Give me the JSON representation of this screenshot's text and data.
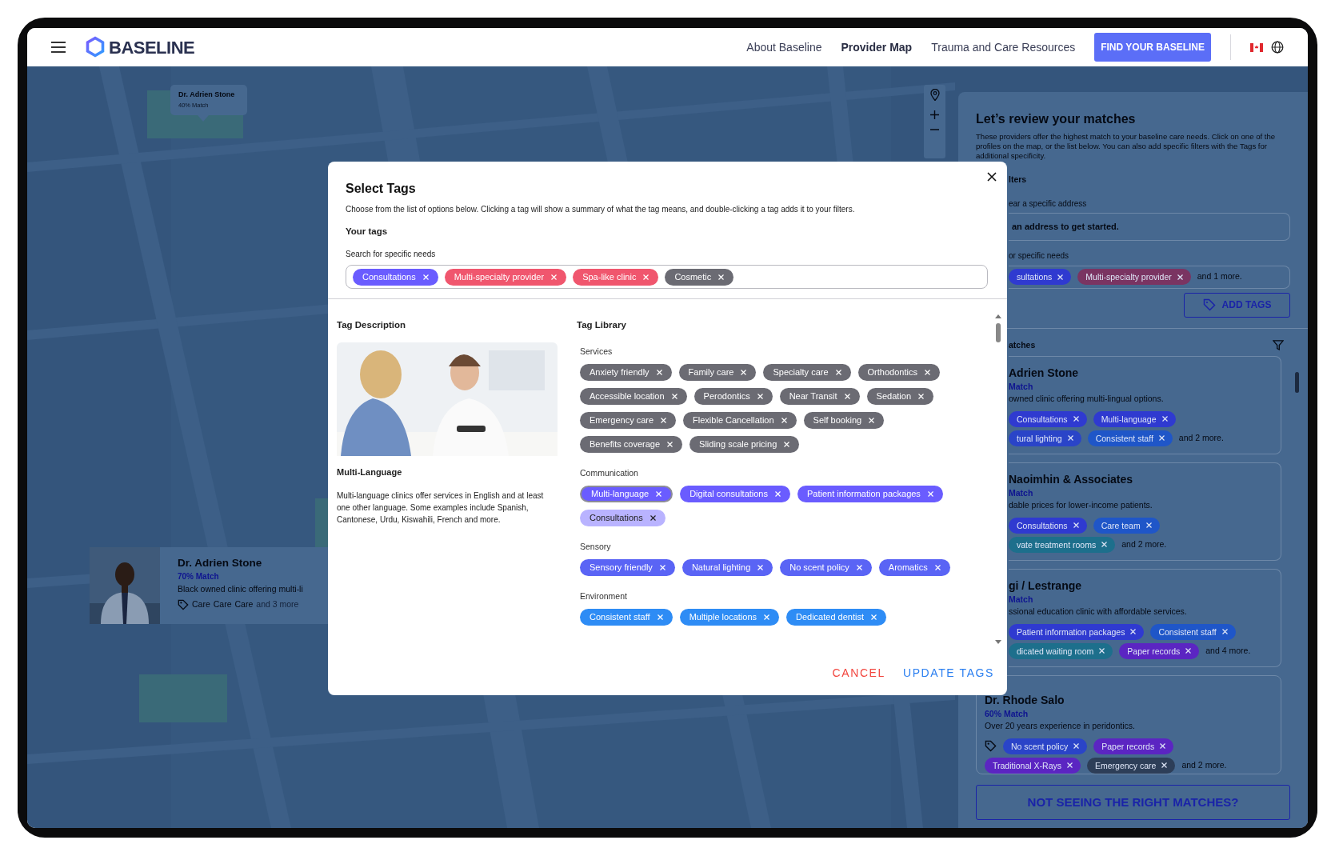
{
  "header": {
    "logo": "BASELINE",
    "nav": [
      {
        "label": "About Baseline",
        "selected": false
      },
      {
        "label": "Provider Map",
        "selected": true
      },
      {
        "label": "Trauma and Care Resources",
        "selected": false
      }
    ],
    "cta": "FIND YOUR BASELINE"
  },
  "map": {
    "kind": "picture",
    "pin": {
      "name": "Dr. Adrien Stone",
      "match": "40% Match"
    },
    "profile_card": {
      "name": "Dr. Adrien Stone",
      "match": "70% Match",
      "description": "Black owned clinic offering multi-li",
      "tags": [
        "Care",
        "Care",
        "Care"
      ],
      "more": "and 3 more"
    }
  },
  "matches_panel": {
    "title": "Let’s review your matches",
    "description": "These providers offer the highest match to your baseline care needs. Click on one of the profiles on the map, or the list below. You can also add specific filters with the Tags for additional specificity.",
    "filters_heading": "lters",
    "address_label": "ear a specific address",
    "address_placeholder": "an address to get started.",
    "needs_label": "or specific needs",
    "needs_tags": [
      {
        "label": "sultations",
        "color": "#2f3ad0"
      },
      {
        "label": "Multi-specialty provider",
        "color": "#7a3462"
      }
    ],
    "needs_more": "and 1 more.",
    "add_tags_button": "ADD TAGS",
    "matches_heading": "atches",
    "matches": [
      {
        "name": "Adrien Stone",
        "match": "Match",
        "description": "owned clinic offering multi-lingual options.",
        "tag_rows": [
          [
            {
              "label": "Consultations",
              "color": "#2f3ad0"
            },
            {
              "label": "Multi-language",
              "color": "#2f3ad0"
            }
          ],
          [
            {
              "label": "tural lighting",
              "color": "#2a44c8"
            },
            {
              "label": "Consistent staff",
              "color": "#1f56c8"
            }
          ]
        ],
        "more": "and 2 more."
      },
      {
        "name": "Naoimhin & Associates",
        "match": "Match",
        "description": "dable prices for lower-income patients.",
        "tag_rows": [
          [
            {
              "label": "Consultations",
              "color": "#2f3ad0"
            },
            {
              "label": "Care team",
              "color": "#1f56c8"
            }
          ],
          [
            {
              "label": "vate treatment rooms",
              "color": "#1d6f8c"
            }
          ]
        ],
        "more": "and 2 more."
      },
      {
        "name": "gi / Lestrange",
        "match": "Match",
        "description": "ssional education clinic with affordable services.",
        "tag_rows": [
          [
            {
              "label": "Patient information packages",
              "color": "#2f3ad0"
            },
            {
              "label": "Consistent staff",
              "color": "#1f56c8"
            }
          ],
          [
            {
              "label": "dicated waiting room",
              "color": "#1d6f8c"
            },
            {
              "label": "Paper records",
              "color": "#5b25c2"
            }
          ]
        ],
        "more": "and 4 more."
      },
      {
        "name": "Dr. Rhode Salo",
        "match": "60% Match",
        "description": "Over 20 years experience in peridontics.",
        "tag_rows": [
          [
            {
              "label": "No scent policy",
              "color": "#2a44c8"
            },
            {
              "label": "Paper records",
              "color": "#5b25c2"
            }
          ],
          [
            {
              "label": "Traditional X-Rays",
              "color": "#5b25c2"
            },
            {
              "label": "Emergency care",
              "color": "#2d3e58"
            }
          ]
        ],
        "more": "and 2 more."
      }
    ],
    "bottom_button": "NOT SEEING THE RIGHT MATCHES?"
  },
  "modal": {
    "title": "Select Tags",
    "description": "Choose from the list of options below. Clicking a tag will show a summary of what the tag means, and double-clicking a tag adds it to your filters.",
    "your_tags_heading": "Your tags",
    "search_label": "Search for specific needs",
    "your_tags": [
      {
        "label": "Consultations",
        "color": "#6a5cff"
      },
      {
        "label": "Multi-specialty provider",
        "color": "#f0566e"
      },
      {
        "label": "Spa-like clinic",
        "color": "#f0566e"
      },
      {
        "label": "Cosmetic",
        "color": "#6b6b73"
      }
    ],
    "description_heading": "Tag Description",
    "tag_name": "Multi-Language",
    "tag_text": "Multi-language clinics offer services in English and at least one other language. Some examples include Spanish, Cantonese, Urdu, Kiswahili, French and more.",
    "library_heading": "Tag Library",
    "groups": [
      {
        "name": "Services",
        "tags": [
          {
            "label": "Anxiety friendly",
            "color": "#6b6b73",
            "selected": false,
            "added": false
          },
          {
            "label": "Family care",
            "color": "#6b6b73",
            "selected": false,
            "added": false
          },
          {
            "label": "Specialty care",
            "color": "#6b6b73",
            "selected": false,
            "added": false
          },
          {
            "label": "Orthodontics",
            "color": "#6b6b73",
            "selected": false,
            "added": false
          },
          {
            "label": "Accessible location",
            "color": "#6b6b73",
            "selected": false,
            "added": false
          },
          {
            "label": "Perodontics",
            "color": "#6b6b73",
            "selected": false,
            "added": false
          },
          {
            "label": "Near Transit",
            "color": "#6b6b73",
            "selected": false,
            "added": false
          },
          {
            "label": "Sedation",
            "color": "#6b6b73",
            "selected": false,
            "added": false
          },
          {
            "label": "Emergency care",
            "color": "#6b6b73",
            "selected": false,
            "added": false
          },
          {
            "label": "Flexible Cancellation",
            "color": "#6b6b73",
            "selected": false,
            "added": false
          },
          {
            "label": "Self booking",
            "color": "#6b6b73",
            "selected": false,
            "added": false
          },
          {
            "label": "Benefits coverage",
            "color": "#6b6b73",
            "selected": false,
            "added": false
          },
          {
            "label": "Sliding scale pricing",
            "color": "#6b6b73",
            "selected": false,
            "added": false
          }
        ]
      },
      {
        "name": "Communication",
        "tags": [
          {
            "label": "Multi-language",
            "color": "#6a5cff",
            "selected": true,
            "added": false
          },
          {
            "label": "Digital consultations",
            "color": "#6a5cff",
            "selected": false,
            "added": false
          },
          {
            "label": "Patient information packages",
            "color": "#6a5cff",
            "selected": false,
            "added": false
          },
          {
            "label": "Consultations",
            "color": "#b9b3ff",
            "selected": false,
            "added": true
          }
        ]
      },
      {
        "name": "Sensory",
        "tags": [
          {
            "label": "Sensory friendly",
            "color": "#5a64f5",
            "selected": false,
            "added": false
          },
          {
            "label": "Natural lighting",
            "color": "#5a64f5",
            "selected": false,
            "added": false
          },
          {
            "label": "No scent policy",
            "color": "#5a64f5",
            "selected": false,
            "added": false
          },
          {
            "label": "Aromatics",
            "color": "#5a64f5",
            "selected": false,
            "added": false
          }
        ]
      },
      {
        "name": "Environment",
        "tags": [
          {
            "label": "Consistent staff",
            "color": "#2e8cf5",
            "selected": false,
            "added": false
          },
          {
            "label": "Multiple locations",
            "color": "#2e8cf5",
            "selected": false,
            "added": false
          },
          {
            "label": "Dedicated dentist",
            "color": "#2e8cf5",
            "selected": false,
            "added": false
          }
        ]
      }
    ],
    "buttons": {
      "cancel": "CANCEL",
      "update": "UPDATE TAGS"
    }
  }
}
